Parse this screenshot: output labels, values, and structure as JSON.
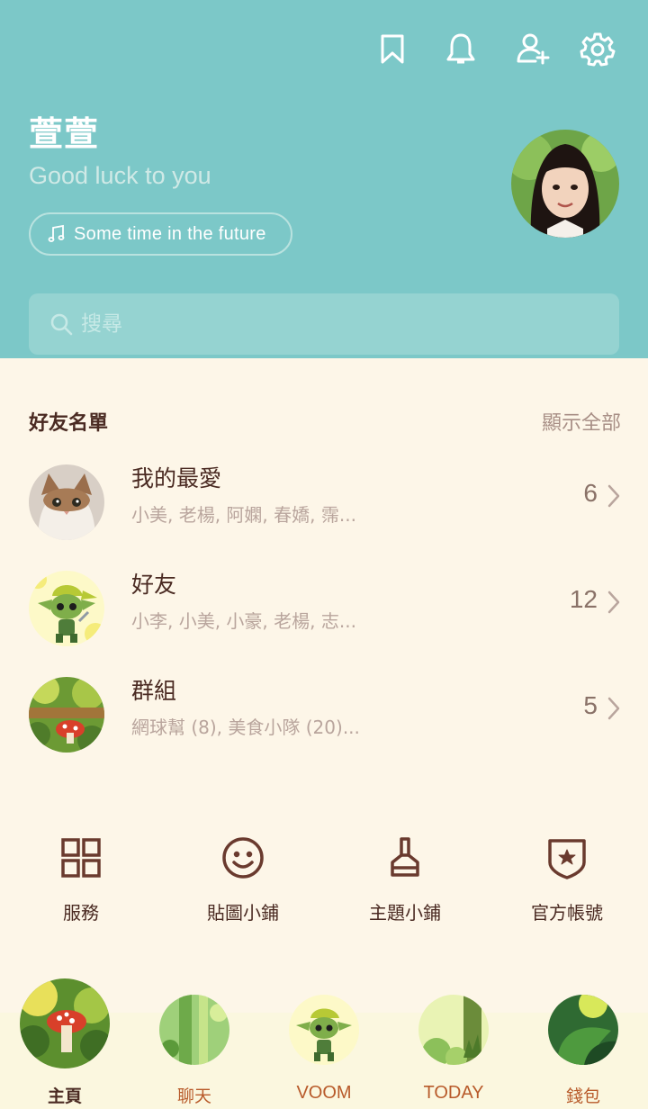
{
  "header": {
    "profile_name": "萱萱",
    "status_message": "Good luck to you",
    "music": "Some time in the future",
    "colors": {
      "header_bg": "#7cc8c8",
      "page_bg": "#fdf6e8",
      "text_dark": "#4a2a22"
    },
    "icons": [
      "bookmark-icon",
      "bell-icon",
      "add-friend-icon",
      "gear-icon"
    ]
  },
  "search": {
    "placeholder": "搜尋"
  },
  "friends": {
    "title": "好友名單",
    "show_all": "顯示全部",
    "groups": [
      {
        "name": "我的最愛",
        "members": "小美, 老楊, 阿嫻, 春嬌, 霈...",
        "count": "6"
      },
      {
        "name": "好友",
        "members": "小李, 小美, 小豪, 老楊, 志...",
        "count": "12"
      },
      {
        "name": "群組",
        "members": "網球幫 (8), 美食小隊 (20)...",
        "count": "5"
      }
    ]
  },
  "shortcuts": [
    {
      "label": "服務",
      "icon": "grid-icon"
    },
    {
      "label": "貼圖小鋪",
      "icon": "smiley-icon"
    },
    {
      "label": "主題小鋪",
      "icon": "brush-icon"
    },
    {
      "label": "官方帳號",
      "icon": "shield-star-icon"
    }
  ],
  "bottom_nav": [
    {
      "label": "主頁",
      "active": true
    },
    {
      "label": "聊天"
    },
    {
      "label": "VOOM"
    },
    {
      "label": "TODAY"
    },
    {
      "label": "錢包"
    }
  ]
}
